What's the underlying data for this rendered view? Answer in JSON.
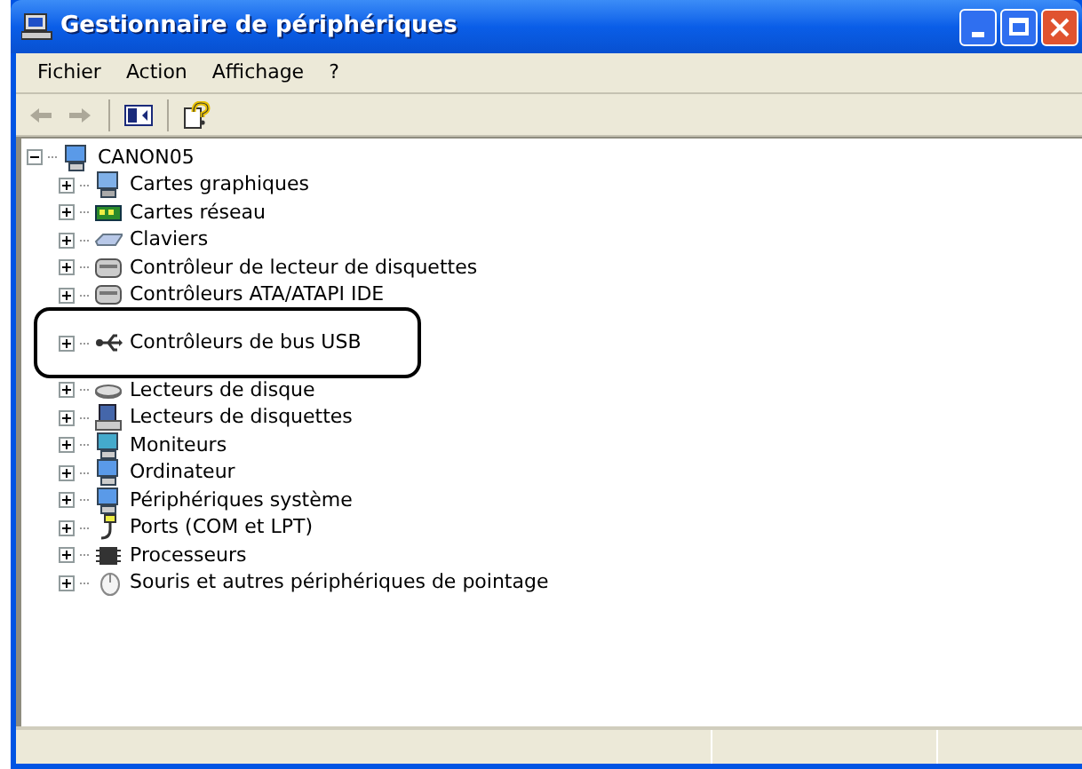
{
  "window": {
    "title": "Gestionnaire de périphériques"
  },
  "menu": [
    {
      "label": "Fichier"
    },
    {
      "label": "Action"
    },
    {
      "label": "Affichage"
    },
    {
      "label": "?"
    }
  ],
  "toolbar": [
    {
      "kind": "back",
      "disabled": true
    },
    {
      "kind": "forward",
      "disabled": true
    },
    {
      "kind": "separator"
    },
    {
      "kind": "tree-toggle",
      "disabled": false
    },
    {
      "kind": "separator"
    },
    {
      "kind": "help",
      "disabled": false
    }
  ],
  "tree": {
    "label": "CANON05",
    "expanded": true,
    "children": [
      {
        "label": "Cartes graphiques",
        "kind": "display",
        "expanded": false
      },
      {
        "label": "Cartes réseau",
        "kind": "network",
        "expanded": false
      },
      {
        "label": "Claviers",
        "kind": "keyboard",
        "expanded": false
      },
      {
        "label": "Contrôleur de lecteur de disquettes",
        "kind": "controller",
        "expanded": false
      },
      {
        "label": "Contrôleurs ATA/ATAPI IDE",
        "kind": "controller",
        "expanded": false
      },
      {
        "label": "Contrôleurs de bus USB",
        "kind": "usb",
        "expanded": false,
        "highlighted": true
      },
      {
        "label": "Lecteurs de disque",
        "kind": "disk",
        "expanded": false
      },
      {
        "label": "Lecteurs de disquettes",
        "kind": "floppy",
        "expanded": false
      },
      {
        "label": "Moniteurs",
        "kind": "monitor",
        "expanded": false
      },
      {
        "label": "Ordinateur",
        "kind": "computer",
        "expanded": false
      },
      {
        "label": "Périphériques système",
        "kind": "computer",
        "expanded": false
      },
      {
        "label": "Ports (COM et LPT)",
        "kind": "port",
        "expanded": false
      },
      {
        "label": "Processeurs",
        "kind": "cpu",
        "expanded": false
      },
      {
        "label": "Souris et autres périphériques de pointage",
        "kind": "mouse",
        "expanded": false
      }
    ]
  }
}
